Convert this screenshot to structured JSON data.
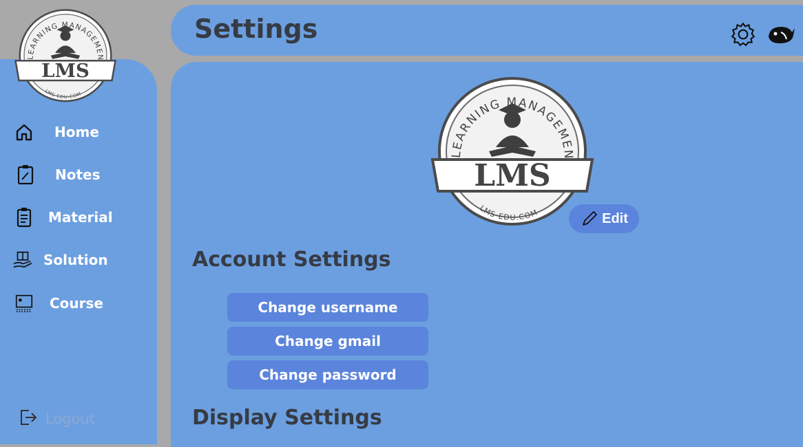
{
  "logo": {
    "text": "LMS",
    "ring_text": "LEARNING MANAGEMENT SYSTEM",
    "url_text": "LMS-EDU.COM"
  },
  "sidebar": {
    "items": [
      {
        "label": "Home",
        "icon": "home-icon"
      },
      {
        "label": "Notes",
        "icon": "notes-icon"
      },
      {
        "label": "Material",
        "icon": "material-icon"
      },
      {
        "label": "Solution",
        "icon": "solution-icon"
      },
      {
        "label": "Course",
        "icon": "course-icon"
      }
    ],
    "logout_label": "Logout"
  },
  "header": {
    "title": "Settings",
    "icons": [
      "gear-icon",
      "whale-icon"
    ]
  },
  "profile": {
    "edit_label": "Edit"
  },
  "account_settings": {
    "title": "Account Settings",
    "buttons": [
      "Change username",
      "Change gmail",
      "Change password"
    ]
  },
  "display_settings": {
    "title": "Display Settings"
  },
  "colors": {
    "background": "#a9a9a9",
    "panel": "#6c9fe0",
    "button": "#5b84dc",
    "heading": "#363b44"
  }
}
